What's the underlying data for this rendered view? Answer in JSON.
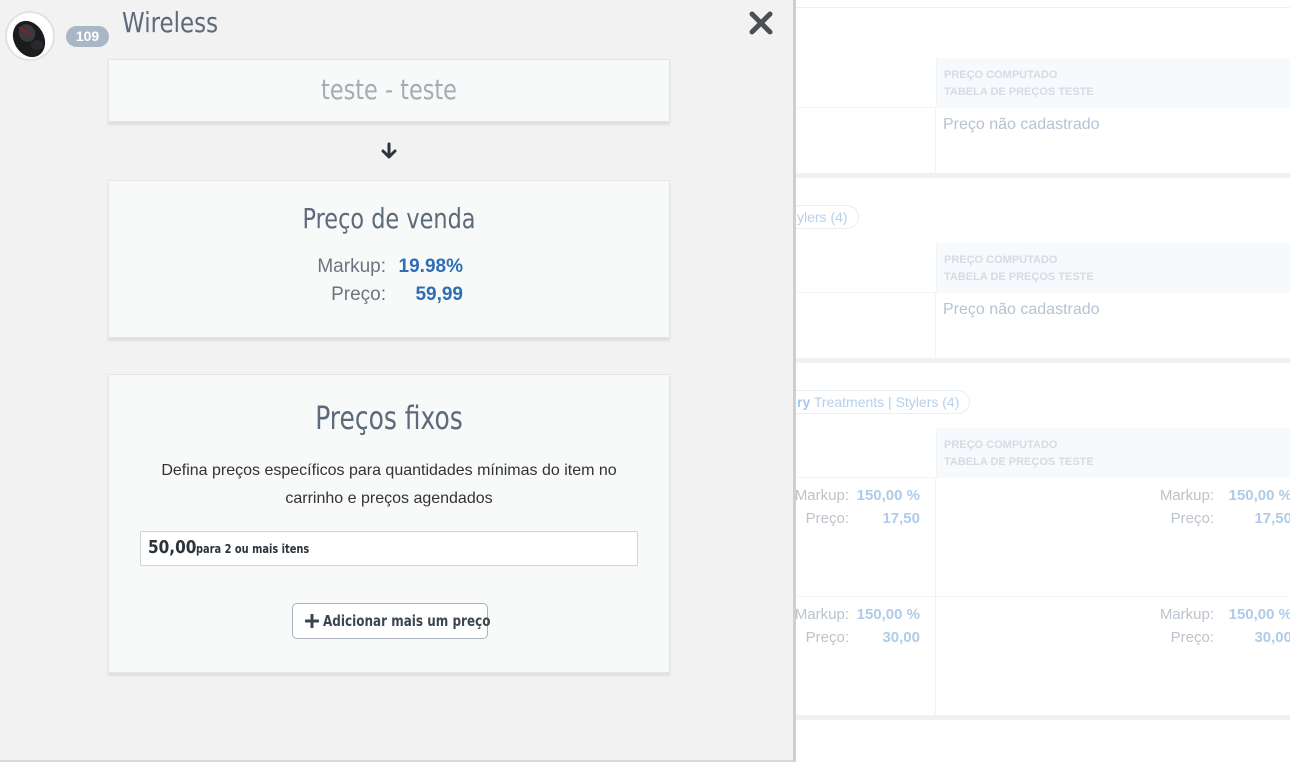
{
  "panel": {
    "title": "Wireless",
    "badge_count": "109",
    "source_label": "teste - teste",
    "sale_card": {
      "title": "Preço de venda",
      "markup_label": "Markup:",
      "markup_value": "19.98%",
      "price_label": "Preço:",
      "price_value": "59,99"
    },
    "fixed_card": {
      "title": "Preços fixos",
      "description": "Defina preços específicos para quantidades mínimas do item no carrinho e preços agendados",
      "prices": [
        {
          "amount": "50,00",
          "condition": "para 2 ou mais itens"
        }
      ],
      "add_button_label": "Adicionar mais um preço"
    }
  },
  "background": {
    "column_header_line1": "PREÇO COMPUTADO",
    "column_header_line2": "TABELA DE PREÇOS TESTE",
    "missing_price": "Preço não cadastrado",
    "chip_2": "ylers (4)",
    "chip_3_strong": "ry",
    "chip_3_rest": " Treatments | Stylers (4)",
    "markup_label": "Markup:",
    "markup_label_cut": "Markup:",
    "price_label": "Preço:",
    "price_label_cut": "Preço:",
    "rows": [
      {
        "markup": "150,00 %",
        "price": "17,50"
      },
      {
        "markup": "150,00 %",
        "price": "30,00"
      }
    ]
  },
  "colors": {
    "accent_blue": "#2d6eb5",
    "badge_bg": "#aab6c5",
    "title_text": "#5d6a7a"
  },
  "icons": {
    "close": "close-icon",
    "arrow": "arrow-down-icon",
    "plus": "plus-icon"
  }
}
